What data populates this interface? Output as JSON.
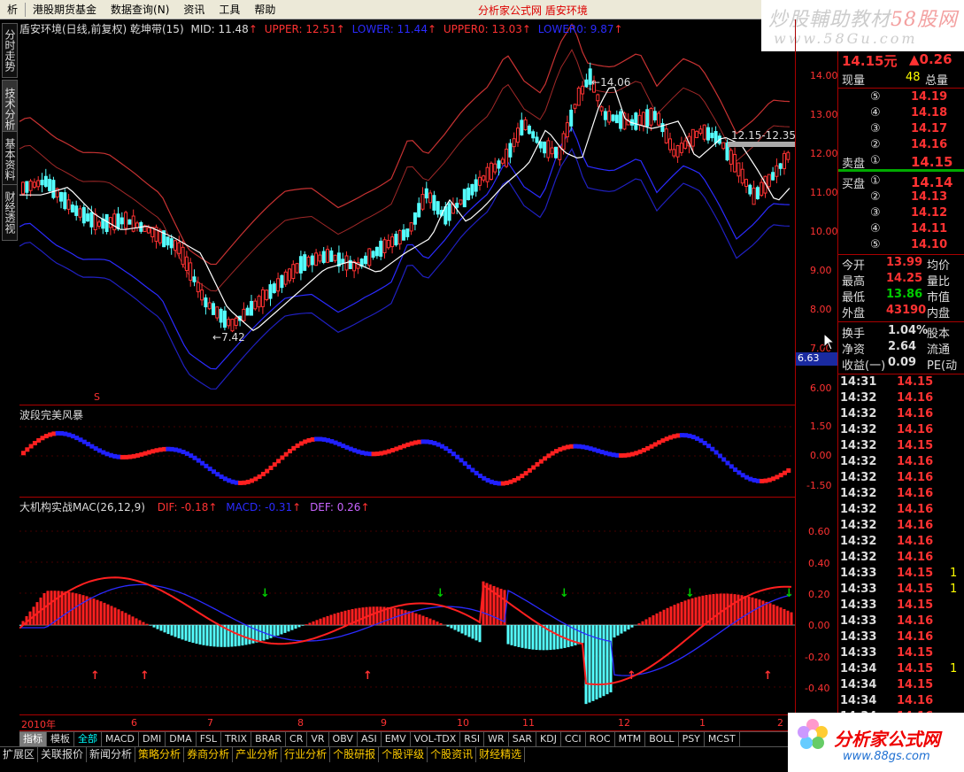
{
  "menu": {
    "items": [
      "析",
      "港股期货基金",
      "数据查询(N)",
      "资讯",
      "工具",
      "帮助"
    ],
    "center_title": "分析家公式网  盾安环境"
  },
  "banner": {
    "line1_a": "炒股輔助教材",
    "line1_b": "58股网",
    "line2": "www.58Gu.com"
  },
  "left_tabs": [
    "分时走势",
    "技术分析",
    "基本资料",
    "财经透视"
  ],
  "main_header": {
    "title": "盾安环境(日线,前复权) 乾坤带(15)",
    "mid": "MID: 11.48",
    "upper": "UPPER: 12.51",
    "lower": "LOWER: 11.44",
    "upper0": "UPPER0: 13.03",
    "lower0": "LOWER0: 9.87"
  },
  "main_annotations": {
    "high": "14.06",
    "low": "7.42",
    "range": "12.15-12.35",
    "marker": "S"
  },
  "main_axis": [
    "14.00",
    "13.00",
    "12.00",
    "11.00",
    "10.00",
    "9.00",
    "8.00",
    "7.00",
    "6.00"
  ],
  "price_box": "6.63",
  "wave": {
    "title": "波段完美风暴",
    "axis": [
      "1.50",
      "0.00",
      "-1.50"
    ]
  },
  "macd": {
    "title": "大机构实战MAC(26,12,9)",
    "dif": "DIF: -0.18",
    "macd": "MACD: -0.31",
    "def": "DEF: 0.26",
    "axis": [
      "0.60",
      "0.40",
      "0.20",
      "0.00",
      "-0.20",
      "-0.40"
    ]
  },
  "xaxis": [
    "2010年",
    "6",
    "7",
    "8",
    "9",
    "10",
    "11",
    "12",
    "1",
    "2"
  ],
  "quote": {
    "price": "14.15元",
    "change": "▲0.26",
    "vol_label": "现量",
    "vol": "48",
    "total_label": "总量",
    "asks": [
      {
        "n": "⑤",
        "p": "14.19"
      },
      {
        "n": "④",
        "p": "14.18"
      },
      {
        "n": "③",
        "p": "14.17"
      },
      {
        "n": "②",
        "p": "14.16"
      },
      {
        "label": "卖盘",
        "n": "①",
        "p": "14.15"
      }
    ],
    "bids": [
      {
        "label": "买盘",
        "n": "①",
        "p": "14.14"
      },
      {
        "n": "②",
        "p": "14.13"
      },
      {
        "n": "③",
        "p": "14.12"
      },
      {
        "n": "④",
        "p": "14.11"
      },
      {
        "n": "⑤",
        "p": "14.10"
      }
    ],
    "stats": [
      {
        "l": "今开",
        "v": "13.99",
        "r": "均价"
      },
      {
        "l": "最高",
        "v": "14.25",
        "r": "量比"
      },
      {
        "l": "最低",
        "v": "13.86",
        "r": "市值"
      },
      {
        "l": "外盘",
        "v": "43190",
        "r": "内盘"
      }
    ],
    "fund": [
      {
        "l": "换手",
        "v": "1.04%",
        "r": "股本"
      },
      {
        "l": "净资",
        "v": "2.64",
        "r": "流通"
      },
      {
        "l": "收益(一)",
        "v": "0.09",
        "r": "PE(动"
      }
    ],
    "ticks": [
      {
        "t": "14:31",
        "p": "14.15",
        "v": ""
      },
      {
        "t": "14:32",
        "p": "14.16",
        "v": ""
      },
      {
        "t": "14:32",
        "p": "14.16",
        "v": ""
      },
      {
        "t": "14:32",
        "p": "14.16",
        "v": ""
      },
      {
        "t": "14:32",
        "p": "14.15",
        "v": ""
      },
      {
        "t": "14:32",
        "p": "14.16",
        "v": ""
      },
      {
        "t": "14:32",
        "p": "14.16",
        "v": ""
      },
      {
        "t": "14:32",
        "p": "14.16",
        "v": ""
      },
      {
        "t": "14:32",
        "p": "14.16",
        "v": ""
      },
      {
        "t": "14:32",
        "p": "14.16",
        "v": ""
      },
      {
        "t": "14:32",
        "p": "14.16",
        "v": ""
      },
      {
        "t": "14:32",
        "p": "14.16",
        "v": ""
      },
      {
        "t": "14:33",
        "p": "14.15",
        "v": "1"
      },
      {
        "t": "14:33",
        "p": "14.15",
        "v": "1"
      },
      {
        "t": "14:33",
        "p": "14.15",
        "v": ""
      },
      {
        "t": "14:33",
        "p": "14.16",
        "v": ""
      },
      {
        "t": "14:33",
        "p": "14.16",
        "v": ""
      },
      {
        "t": "14:33",
        "p": "14.15",
        "v": ""
      },
      {
        "t": "14:34",
        "p": "14.15",
        "v": "1"
      },
      {
        "t": "14:34",
        "p": "14.15",
        "v": ""
      },
      {
        "t": "14:34",
        "p": "14.16",
        "v": ""
      },
      {
        "t": "14:34",
        "p": "14.16",
        "v": ""
      },
      {
        "t": "14:34",
        "p": "14.15",
        "v": ""
      },
      {
        "t": "14:34",
        "p": "14.16",
        "v": ""
      }
    ]
  },
  "tabs_indicator": [
    "指标",
    "模板",
    "全部",
    "MACD",
    "DMI",
    "DMA",
    "FSL",
    "TRIX",
    "BRAR",
    "CR",
    "VR",
    "OBV",
    "ASI",
    "EMV",
    "VOL-TDX",
    "RSI",
    "WR",
    "SAR",
    "KDJ",
    "CCI",
    "ROC",
    "MTM",
    "BOLL",
    "PSY",
    "MCST"
  ],
  "tabs_function": [
    "扩展区",
    "关联报价",
    "新闻分析",
    "策略分析",
    "券商分析",
    "产业分析",
    "行业分析",
    "个股研报",
    "个股评级",
    "个股资讯",
    "财经精选"
  ],
  "logo2": {
    "text": "分析家公式网",
    "url": "www.88gs.com"
  },
  "colors": {
    "up": "#ff3232",
    "down": "#00ffff",
    "blue": "#2b2bff",
    "yellow": "#ffff00",
    "axis": "#ff3232",
    "frame": "#a00000"
  }
}
